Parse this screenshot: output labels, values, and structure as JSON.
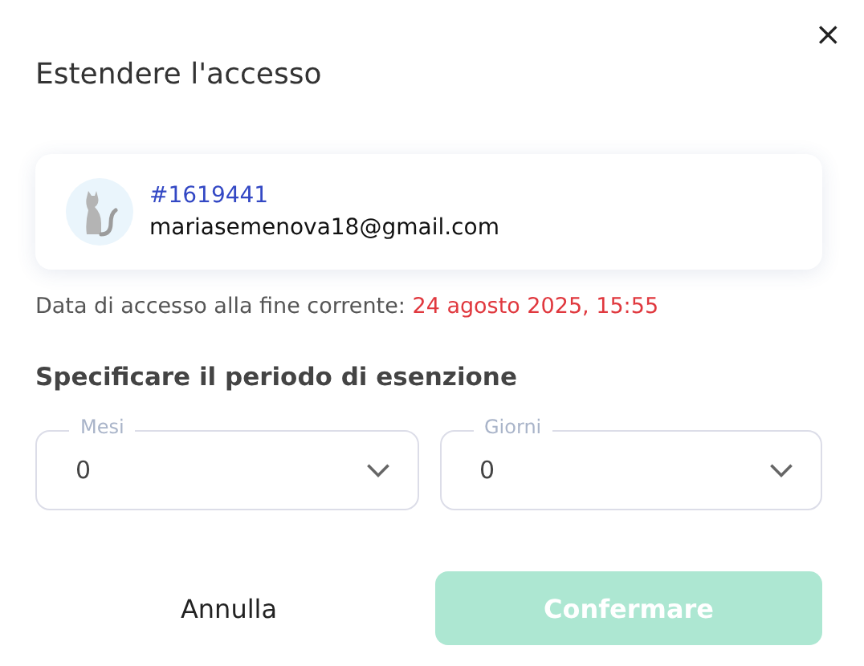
{
  "dialog": {
    "close": "×",
    "title": "Estendere l'accesso"
  },
  "user": {
    "id": "#1619441",
    "email": "mariasemenova18@gmail.com"
  },
  "access": {
    "label": "Data di accesso alla fine corrente:",
    "date": "24 agosto 2025, 15:55"
  },
  "section_title": "Specificare il periodo di esenzione",
  "selects": [
    {
      "label": "Mesi",
      "value": "0"
    },
    {
      "label": "Giorni",
      "value": "0"
    }
  ],
  "buttons": {
    "cancel": "Annulla",
    "confirm": {
      "label": "Confermare",
      "disabled": true
    }
  }
}
